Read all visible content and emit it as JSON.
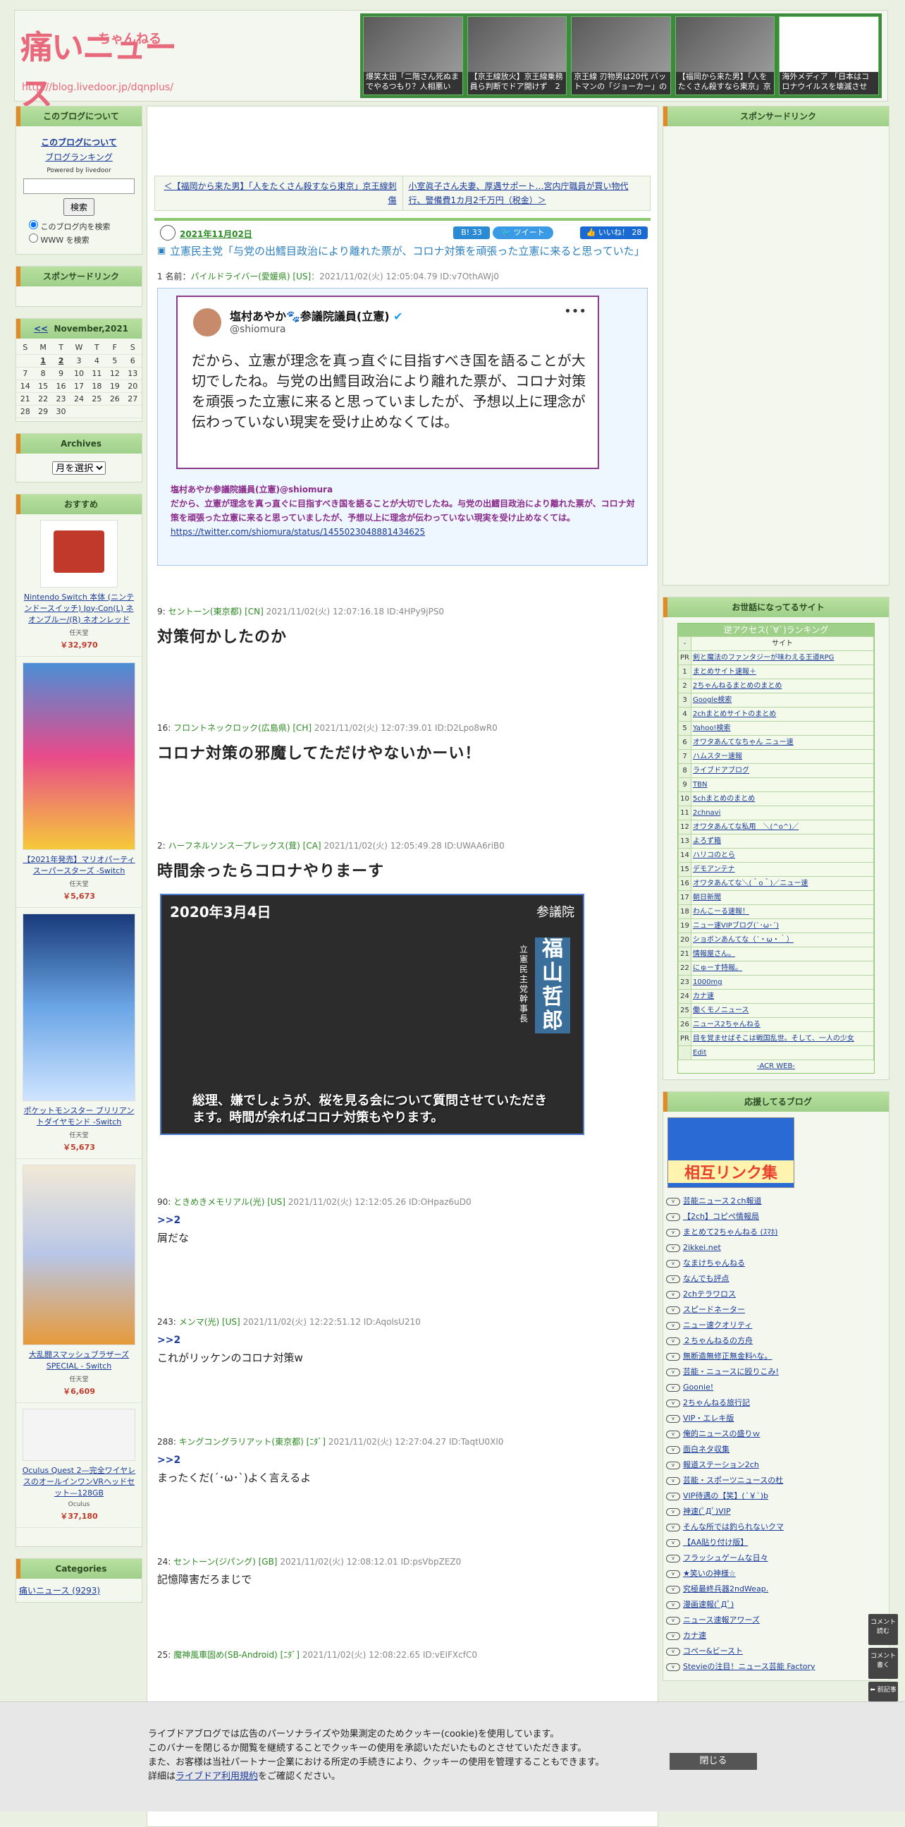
{
  "header": {
    "logo_main": "痛いニュース",
    "logo_sub": "ちゃんねる",
    "logo_url": "http://blog.livedoor.jp/dqnplus/",
    "headlines": [
      "爆笑太田「二階さん死ぬまでやるつもり？人相悪い",
      "【京王線放火】京王線乗務員ら判断でドア開けず　2",
      "京王線 刃物男は20代 バットマンの「ジョーカー」の",
      "【福岡から来た男】「人をたくさん殺すなら東京」京",
      "海外メディア 「日本はコロナウイルスを壊滅させた！"
    ]
  },
  "left": {
    "about_title": "このブログについて",
    "about_link": "このブログについて",
    "ranking_link": "ブログランキング",
    "powered": "Powered by livedoor",
    "search_button": "検索",
    "radio1": "このブログ内を検索",
    "radio2": "WWW を検索",
    "sponsor_title": "スポンサードリンク",
    "cal_prev": "<<",
    "cal_title": "November,2021",
    "cal_days": [
      "S",
      "M",
      "T",
      "W",
      "T",
      "F",
      "S"
    ],
    "cal_rows": [
      [
        "",
        "1",
        "2",
        "3",
        "4",
        "5",
        "6"
      ],
      [
        "7",
        "8",
        "9",
        "10",
        "11",
        "12",
        "13"
      ],
      [
        "14",
        "15",
        "16",
        "17",
        "18",
        "19",
        "20"
      ],
      [
        "21",
        "22",
        "23",
        "24",
        "25",
        "26",
        "27"
      ],
      [
        "28",
        "29",
        "30",
        "",
        "",
        "",
        ""
      ]
    ],
    "archives_title": "Archives",
    "archives_select": "月を選択",
    "recommend_title": "おすすめ",
    "recommend": [
      {
        "name": "Nintendo Switch 本体 (ニンテンドースイッチ) Joy-Con(L) ネオンブルー/(R) ネオンレッド",
        "shop": "任天堂",
        "price": "￥32,970"
      },
      {
        "name": "【2021年発売】マリオパーティ スーパースターズ -Switch",
        "shop": "任天堂",
        "price": "￥5,673"
      },
      {
        "name": "ポケットモンスター ブリリアントダイヤモンド -Switch",
        "shop": "任天堂",
        "price": "￥5,673"
      },
      {
        "name": "大乱闘スマッシュブラザーズ SPECIAL - Switch",
        "shop": "任天堂",
        "price": "￥6,609"
      },
      {
        "name": "Oculus Quest 2—完全ワイヤレスのオールインワンVRヘッドセット—128GB",
        "shop": "Oculus",
        "price": "￥37,180"
      }
    ],
    "categories_title": "Categories",
    "category_first": "痛いニュース (9293)"
  },
  "main": {
    "nav_prev": "＜【福岡から来た男】「人をたくさん殺すなら東京」京王線刺傷",
    "nav_next": "小室眞子さん夫妻、厚遇サポート…宮内庁職員が買い物代行、警備費1カ月2千万円（税金）＞",
    "date": "2021年11月02日",
    "hatena": "B! 33",
    "tweet": "ツイート",
    "like": "いいね！ 28",
    "title": "立憲民主党「与党の出鱈目政治により離れた票が、コロナ対策を頑張った立憲に来ると思っていた」",
    "res1_head_num": "1 名前：",
    "res1_head_name": "パイルドライバー(愛媛県) [US]",
    "res1_head_rest": "：2021/11/02(火) 12:05:04.79 ID:v7OthAWj0",
    "tweet_user": "塩村あやか🐾参議院議員(立憲)",
    "tweet_handle": "@shiomura",
    "tweet_body": "だから、立憲が理念を真っ直ぐに目指すべき国を語ることが大切でしたね。与党の出鱈目政治により離れた票が、コロナ対策を頑張った立憲に来ると思っていましたが、予想以上に理念が伝わっていない現実を受け止めなくては。",
    "tweet_quote_head": "塩村あやか参議院議員(立憲)@shiomura",
    "tweet_quote_body": "だから、立憲が理念を真っ直ぐに目指すべき国を語ることが大切でしたね。与党の出鱈目政治により離れた票が、コロナ対策を頑張った立憲に来ると思っていましたが、予想以上に理念が伝わっていない現実を受け止めなくては。",
    "tweet_link": "https://twitter.com/shiomura/status/1455023048881434625",
    "video_date": "2020年3月4日",
    "video_place": "参議院",
    "video_name": "福山哲郎",
    "video_party": "立憲民主党 幹事長",
    "video_caption": "総理、嫌でしょうが、桜を見る会について質問させていただきます。時間が余ればコロナ対策もやります。",
    "responses": [
      {
        "num": "9:",
        "name": "セントーン(東京都) [CN]",
        "meta": "2021/11/02(火) 12:07:16.18 ID:4HPy9jPS0",
        "anchor": "",
        "text": "対策何かしたのか",
        "big": true
      },
      {
        "num": "16:",
        "name": "フロントネックロック(広島県) [CH]",
        "meta": "2021/11/02(火) 12:07:39.01 ID:D2Lpo8wR0",
        "anchor": "",
        "text": "コロナ対策の邪魔してただけやないかーい！",
        "big": true
      },
      {
        "num": "2:",
        "name": "ハーフネルソンスープレックス(茸) [CA]",
        "meta": "2021/11/02(火) 12:05:49.28 ID:UWAA6riB0",
        "anchor": "",
        "text": "時間余ったらコロナやりまーす",
        "big": true
      },
      {
        "num": "90:",
        "name": "ときめきメモリアル(光) [US]",
        "meta": "2021/11/02(火) 12:12:05.26 ID:OHpaz6uD0",
        "anchor": ">>2",
        "text": "屑だな",
        "big": false
      },
      {
        "num": "243:",
        "name": "メンマ(光) [US]",
        "meta": "2021/11/02(火) 12:22:51.12 ID:AqolsU210",
        "anchor": ">>2",
        "text": "これがリッケンのコロナ対策w",
        "big": false
      },
      {
        "num": "288:",
        "name": "キングコングラリアット(東京都) [ﾆﾀﾞ]",
        "meta": "2021/11/02(火) 12:27:04.27 ID:TaqtU0Xl0",
        "anchor": ">>2",
        "text": "まったくだ(´･ω･`)よく言えるよ",
        "big": false
      },
      {
        "num": "24:",
        "name": "セントーン(ジパング) [GB]",
        "meta": "2021/11/02(火) 12:08:12.01 ID:psVbpZEZ0",
        "anchor": "",
        "text": "記憶障害だろまじで",
        "big": false
      },
      {
        "num": "25:",
        "name": "魔神風車固め(SB-Android) [ﾆﾀﾞ]",
        "meta": "2021/11/02(火) 12:08:22.65 ID:vEIFXcfC0",
        "anchor": "",
        "text": "",
        "big": false
      }
    ]
  },
  "right": {
    "sponsor_title": "スポンサードリンク",
    "sites_title": "お世話になってるサイト",
    "rank_title": "逆アクセス(´∀`)ランキング",
    "rank_col": "サイト",
    "rank": [
      [
        "PR",
        "剣と魔法のファンタジーが味わえる王道RPG"
      ],
      [
        "1",
        "まとめサイト速報＋"
      ],
      [
        "2",
        "2ちゃんねるまとめのまとめ"
      ],
      [
        "3",
        "Google検索"
      ],
      [
        "4",
        "2chまとめサイトのまとめ"
      ],
      [
        "5",
        "Yahoo!検索"
      ],
      [
        "6",
        "オワタあんてなちゃん ニュー速"
      ],
      [
        "7",
        "ハムスター速報"
      ],
      [
        "8",
        "ライブドアブログ"
      ],
      [
        "9",
        "TBN"
      ],
      [
        "10",
        "5chまとめのまとめ"
      ],
      [
        "11",
        "2chnavi"
      ],
      [
        "12",
        "オワタあんてな私用　＼(^o^)／"
      ],
      [
        "13",
        "よろず箱"
      ],
      [
        "14",
        "ハリコのとら"
      ],
      [
        "15",
        "デモアンテナ"
      ],
      [
        "16",
        "オワタあんてな＼(＾o＾)／ニュー速"
      ],
      [
        "17",
        "朝日新聞"
      ],
      [
        "18",
        "わんこーる速報！"
      ],
      [
        "19",
        "ニュー速VIPブログ(`･ω･´)"
      ],
      [
        "20",
        "ショボンあんてな（´・ω・｀）"
      ],
      [
        "21",
        "情報屋さん。"
      ],
      [
        "22",
        "にゅーす特報。"
      ],
      [
        "23",
        "1000mg"
      ],
      [
        "24",
        "カナ速"
      ],
      [
        "25",
        "働くモノニュース"
      ],
      [
        "26",
        "ニュース2ちゃんねる"
      ],
      [
        "PR",
        "目を覚ませばそこは戦国乱世。そして、一人の少女"
      ],
      [
        "",
        "Edit"
      ]
    ],
    "rank_footer": "-ACR WEB-",
    "blogs_title": "応援してるブログ",
    "banner": "相互リンク集",
    "blogs": [
      "芸能ニュース２ch報道",
      "【2ch】コピペ情報局",
      "まとめて2ちゃんねる (ｽﾏﾎ)",
      "2ikkei.net",
      "なまけちゃんねる",
      "なんでも評点",
      "2chテラワロス",
      "スピードネーター",
      "ニュー速クオリティ",
      "２ちゃんねるの方舟",
      "無断造無修正無金料ﾍな。",
      "芸能・ニュースに殴りこみ!",
      "Goonie!",
      "2ちゃんねる旅行記",
      "VIP・エレキ版",
      "俺的ニュースの盛りｗ",
      "面白ネタ収集",
      "報道ステーション2ch",
      "芸能・スポーツニュースの杜",
      "VIP待遇の【笑】(´￥`)b",
      "神速(ﾟДﾟ)VIP",
      "そんな所では釣られないクマ",
      "【AA貼り付け版】",
      "フラッシュゲームな日々",
      "★笑いの神様☆",
      "究極最終兵器2ndWeap.",
      "漫画速報(ﾟДﾟ)",
      "ニュース速報アワーズ",
      "カナ速",
      "コペー&ビースト",
      "Stevieの注目！ニュース芸能 Factory"
    ]
  },
  "cookie": {
    "line1": "ライブドアブログでは広告のパーソナライズや効果測定のためクッキー(cookie)を使用しています。",
    "line2": "このバナーを閉じるか閲覧を継続することでクッキーの使用を承認いただいたものとさせていただきます。",
    "line3": "また、お客様は当社パートナー企業における所定の手続きにより、クッキーの使用を管理することもできます。",
    "line4a": "詳細は",
    "line4_link": "ライブドア利用規約",
    "line4b": "をご確認ください。",
    "close": "閉じる"
  },
  "floating": {
    "comment_read": "コメント読む",
    "comment_write": "コメント書く",
    "prev": "前記事"
  }
}
